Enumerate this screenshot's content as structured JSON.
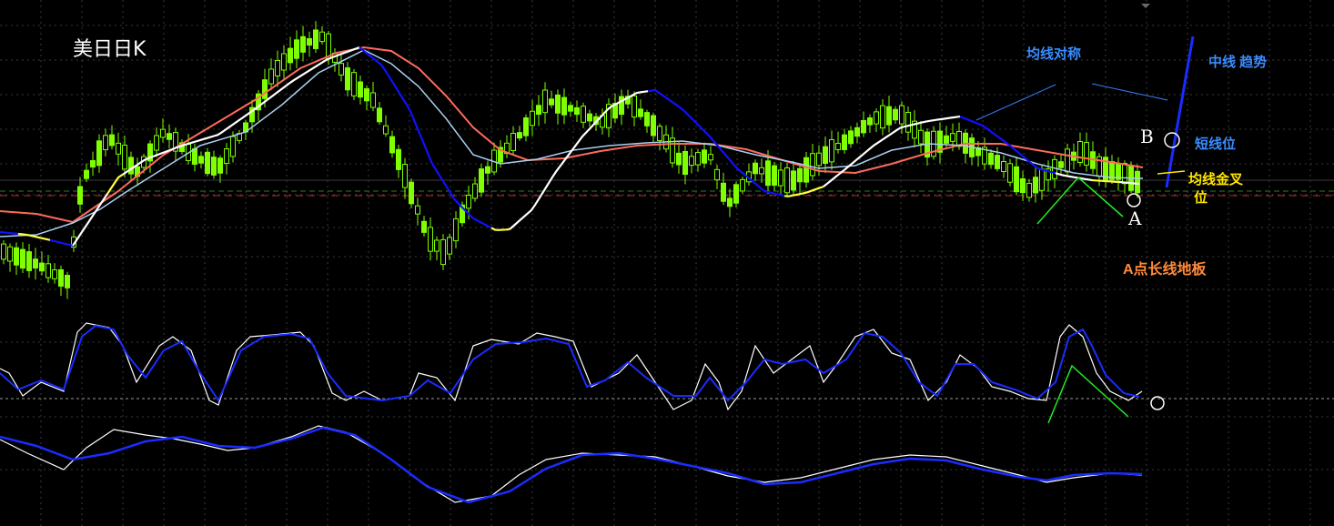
{
  "chart_title": "美日日K",
  "colors": {
    "background": "#000000",
    "grid": "#3a3a3a",
    "candle": "#7fff00",
    "ma_long": "#ff6a5a",
    "ma_mid_blue": "#1010ff",
    "ma_mid_white": "#ffffff",
    "ma_mid_yellow": "#ffff40",
    "ma_short": "#a8cff0",
    "annotation_blue": "#3a8cff",
    "annotation_yellow": "#ffe600",
    "annotation_orange": "#ff8a3a",
    "annotation_green": "#22ee22",
    "trend_line": "#1a2cff"
  },
  "annotations": {
    "symmetry": "均线对称",
    "mid_trend": "中线 趋势",
    "short_pos": "短线位",
    "golden_cross_1": "均线金叉",
    "golden_cross_2": "位",
    "floor": "A点长线地板",
    "label_a": "A",
    "label_b": "B"
  },
  "chart_data": [
    {
      "type": "candlestick",
      "title": "美日日K",
      "ohlc_scale": "relative 0-100",
      "candles": [],
      "moving_averages": [
        "long",
        "mid",
        "short"
      ],
      "grid": true
    },
    {
      "type": "line",
      "series": [
        {
          "values": []
        },
        {
          "values": []
        }
      ],
      "grid": true
    },
    {
      "type": "line",
      "series": [
        {
          "values": []
        },
        {
          "values": []
        }
      ],
      "grid": true
    }
  ]
}
